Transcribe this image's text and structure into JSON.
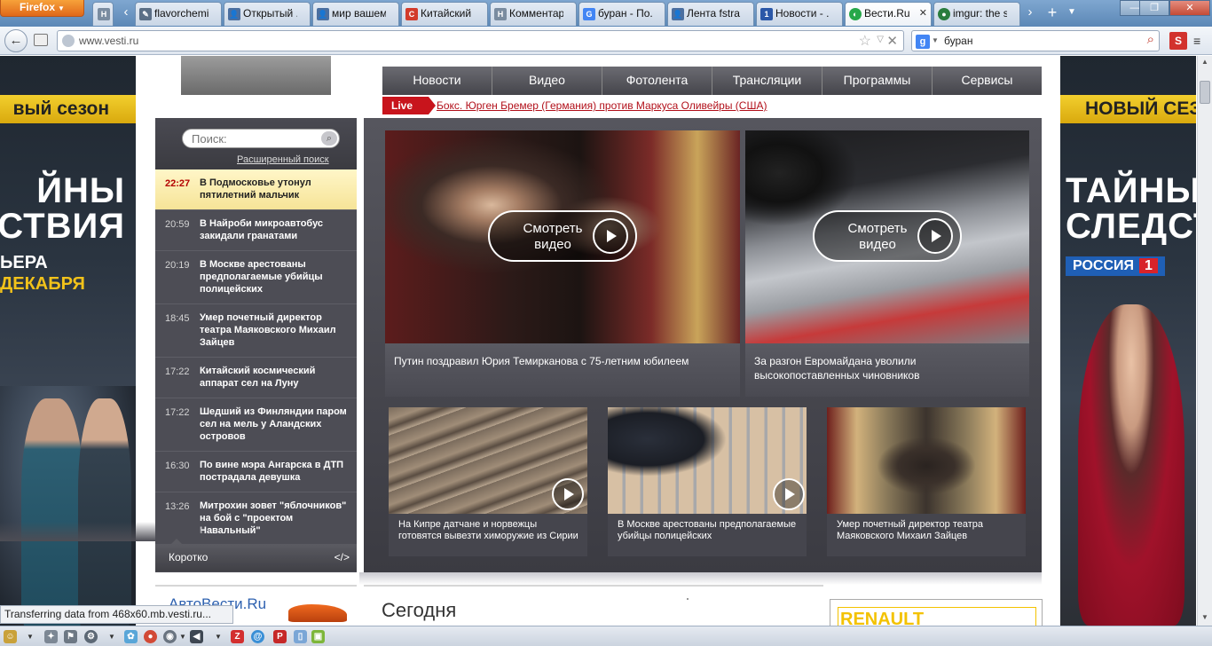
{
  "browser": {
    "menu_button_label": "Firefox",
    "tabs": [
      {
        "title": "",
        "icon": "news-icon",
        "color": "#7a8ca0"
      },
      {
        "title": "flavorchemi...",
        "icon": "pin-icon",
        "color": "#5b6f86"
      },
      {
        "title": "Открытый ...",
        "icon": "user-icon",
        "color": "#4b6fa0"
      },
      {
        "title": "мир вашем...",
        "icon": "user-icon",
        "color": "#4b6fa0"
      },
      {
        "title": "Китайский ...",
        "icon": "c-icon",
        "color": "#d23b2b"
      },
      {
        "title": "Комментар...",
        "icon": "news-icon",
        "color": "#7a8ca0"
      },
      {
        "title": "буран - По...",
        "icon": "google-icon",
        "color": "#4285f4"
      },
      {
        "title": "Лента fstra...",
        "icon": "user-icon",
        "color": "#4b6fa0"
      },
      {
        "title": "Новости - ...",
        "icon": "channel-one-icon",
        "color": "#2b58a8"
      },
      {
        "title": "Вести.Ru",
        "icon": "vesti-icon",
        "color": "#27a84a",
        "active": true
      },
      {
        "title": "imgur: the s...",
        "icon": "imgur-icon",
        "color": "#2a7d3e"
      }
    ],
    "url": "www.vesti.ru",
    "search_query": "буран",
    "status_text": "Transferring data from 468x60.mb.vesti.ru..."
  },
  "site": {
    "menu": [
      "Новости",
      "Видео",
      "Фотолента",
      "Трансляции",
      "Программы",
      "Сервисы"
    ],
    "live_label": "Live",
    "live_headline": "Бокс. Юрген Бремер (Германия) против Маркуса Оливейры (США)",
    "search_placeholder": "Поиск:",
    "advanced_search": "Расширенный поиск",
    "news": [
      {
        "time": "22:27",
        "headline": "В Подмосковье утонул пятилетний мальчик"
      },
      {
        "time": "20:59",
        "headline": "В Найроби микроавтобус закидали гранатами"
      },
      {
        "time": "20:19",
        "headline": "В Москве арестованы предполагаемые убийцы полицейских"
      },
      {
        "time": "18:45",
        "headline": "Умер почетный директор театра Маяковского Михаил Зайцев"
      },
      {
        "time": "17:22",
        "headline": "Китайский космический аппарат сел на Луну"
      },
      {
        "time": "17:22",
        "headline": "Шедший из Финляндии паром сел на мель у Аландских островов"
      },
      {
        "time": "16:30",
        "headline": "По вине мэра Ангарска в ДТП пострадала девушка"
      },
      {
        "time": "13:26",
        "headline": "Митрохин зовет \"яблочников\" на бой с \"проектом Навальный\""
      }
    ],
    "news_footer": {
      "brief": "Коротко",
      "code": "</>"
    },
    "watch_label": "Смотреть видео",
    "big_videos": [
      {
        "caption": "Путин поздравил Юрия Темирканова с 75-летним юбилеем"
      },
      {
        "caption": "За разгон Евромайдана уволили высокопоставленных чиновников"
      }
    ],
    "small_videos": [
      {
        "caption": "На Кипре датчане и норвежцы готовятся вывезти химоружие из Сирии"
      },
      {
        "caption": "В Москве арестованы предполагаемые убийцы полицейских"
      },
      {
        "caption": "Умер почетный директор театра Маяковского Михаил Зайцев"
      }
    ],
    "avtovesti": "АвтоВести.Ru",
    "today": "Сегодня",
    "renault": "RENAULT"
  },
  "ads": {
    "left": {
      "band": "вый сезон",
      "title_1": "ЙНЫ",
      "title_2": "ЕДСТВИЯ",
      "sub_1": "ЬЕРА",
      "sub_2": "ДЕКАБРЯ"
    },
    "right": {
      "band": "НОВЫЙ СЕЗ",
      "title_1": "ТАЙНЫ",
      "title_2": "СЛЕДСТВ",
      "channel": "РОССИЯ",
      "channel_num": "1"
    }
  },
  "colors": {
    "live": "#c8141c",
    "link": "#b2101a",
    "panel": "#4d4d55"
  }
}
